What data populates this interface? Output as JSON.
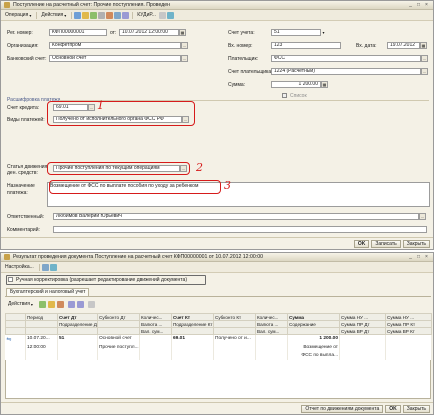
{
  "doc_window": {
    "title": "Поступление на расчетный счет: Прочие поступления. Проведен",
    "toolbar": {
      "operation": "Операция",
      "actions": "Действия",
      "kudir": "КУДиР..."
    },
    "fields": {
      "reg_number_label": "Рег. номер:",
      "reg_number": "КФП00000001",
      "date_from_label": "от:",
      "date_from": "10.07.2012 12:00:00",
      "organization_label": "Организация:",
      "organization": "Конфетпром",
      "bank_account_label": "Банковский счет:",
      "bank_account": "Основной счет",
      "account_label": "Счет учета:",
      "account": "51",
      "incoming_number_label": "Вх. номер:",
      "incoming_number": "123",
      "incoming_date_label": "Вх. дата:",
      "incoming_date": "19.07.2012",
      "payer_label": "Плательщик:",
      "payer": "ФСС",
      "payer_account_label": "Счет плательщика:",
      "payer_account": "1224 (Расчетный)",
      "amount_label": "Сумма:",
      "amount": "1 200.00",
      "list_label": "Список"
    },
    "payment_section": {
      "title": "Расшифровка платежа",
      "credit_account_label": "Счет кредита:",
      "credit_account": "69.01",
      "payment_types_label": "Виды платежей:",
      "payment_types": "Получено от исполнительного органа ФСС РФ",
      "cash_flow_label_1": "Статья движения",
      "cash_flow_label_2": "ден. средств:",
      "cash_flow": "Прочие поступления по текущим операциям",
      "purpose_label_1": "Назначение",
      "purpose_label_2": "платежа:",
      "purpose": "Возмещение от ФСС  по выплате пособия по уходу за ребенком",
      "responsible_label": "Ответственный:",
      "responsible": "Любимов Валерий Юрьевич",
      "comment_label": "Комментарий:",
      "comment": ""
    },
    "annotations": [
      "1",
      "2",
      "3"
    ],
    "buttons": {
      "ok": "OK",
      "save": "Записать",
      "close": "Закрыть"
    }
  },
  "result_window": {
    "title": "Результат проведения документа Поступление на расчетный счет КФП00000001 от 10.07.2012 12:00:00",
    "toolbar": {
      "settings": "Настройка..."
    },
    "manual_edit_label": "Ручная корректировка (разрешает редактирование движений документа)",
    "tab_label": "Бухгалтерский и налоговый учет",
    "actions_label": "Действия",
    "table": {
      "header_row1": [
        "",
        "Период",
        "Счет Дт",
        "Субконто Дт",
        "Количес...",
        "Счет Кт",
        "Субконто Кт",
        "Количес...",
        "Сумма",
        "Сумма НУ ...",
        "Сумма НУ ..."
      ],
      "header_row2": [
        "",
        "",
        "Подразделение Дт",
        "",
        "Валюта ...",
        "Подразделение Кт",
        "",
        "Валюта ...",
        "Содержание",
        "Сумма ПР Дт",
        "Сумма ПР Кт"
      ],
      "header_row3": [
        "",
        "",
        "",
        "",
        "Вал. сум...",
        "",
        "",
        "Вал. сум...",
        "",
        "Сумма ВР Дт",
        "Сумма ВР Кт"
      ],
      "rows": [
        {
          "period": "10.07.20...",
          "period_time": "12:00:00",
          "debit_account": "51",
          "subconto_dt": "Основной счет",
          "subconto_dt_2": "Прочие поступл...",
          "credit_account": "69.01",
          "subconto_kt": "Получено от и...",
          "amount": "1 200.00",
          "content_1": "Возмещение от",
          "content_2": "ФСС  по выпла..."
        }
      ]
    },
    "buttons": {
      "report": "Отчет по движениям документа",
      "ok": "OK",
      "close": "Закрыть"
    }
  },
  "colors": {
    "annotation": "#d61b1b",
    "window_bg": "#f4f1e6",
    "group_title": "#4a5a8a"
  }
}
